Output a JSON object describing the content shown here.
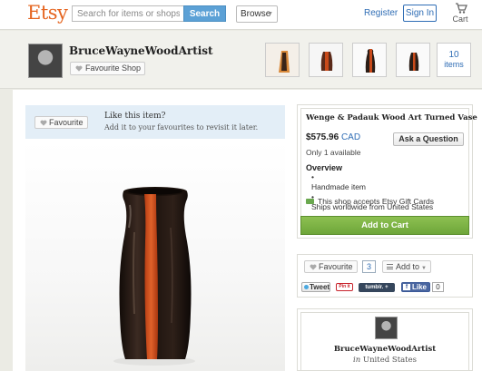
{
  "header": {
    "logo": "Etsy",
    "search_placeholder": "Search for items or shops",
    "search_button": "Search",
    "browse": "Browse",
    "register": "Register",
    "sign_in": "Sign In",
    "cart": "Cart"
  },
  "shop": {
    "name": "BruceWayneWoodArtist",
    "favourite_shop": "Favourite Shop",
    "item_count": "10",
    "items_label": "items"
  },
  "favourite_prompt": {
    "button": "Favourite",
    "title": "Like this item?",
    "subtitle": "Add it to your favourites to revisit it later."
  },
  "listing": {
    "title": "Wenge & Padauk Wood Art Turned Vase",
    "price": "$575.96",
    "currency": "CAD",
    "availability": "Only 1 available",
    "ask_question": "Ask a Question",
    "overview_label": "Overview",
    "overview": [
      "Handmade item",
      "Ships worldwide from United States"
    ],
    "gift_cards": "This shop accepts Etsy Gift Cards",
    "add_to_cart": "Add to Cart"
  },
  "social": {
    "favourite": "Favourite",
    "favourite_count": "3",
    "add_to": "Add to",
    "tweet": "Tweet",
    "pinit": "Pin it",
    "tumblr": "tumblr. +",
    "like": "Like",
    "like_count": "0"
  },
  "seller": {
    "name": "BruceWayneWoodArtist",
    "location_prefix": "in",
    "location": "United States"
  },
  "colors": {
    "etsy_orange": "#e5641f",
    "link_blue": "#2f6db5",
    "cart_green": "#76ad40",
    "wenge_dark": "#2b1d16",
    "padauk_orange": "#d4501c"
  }
}
